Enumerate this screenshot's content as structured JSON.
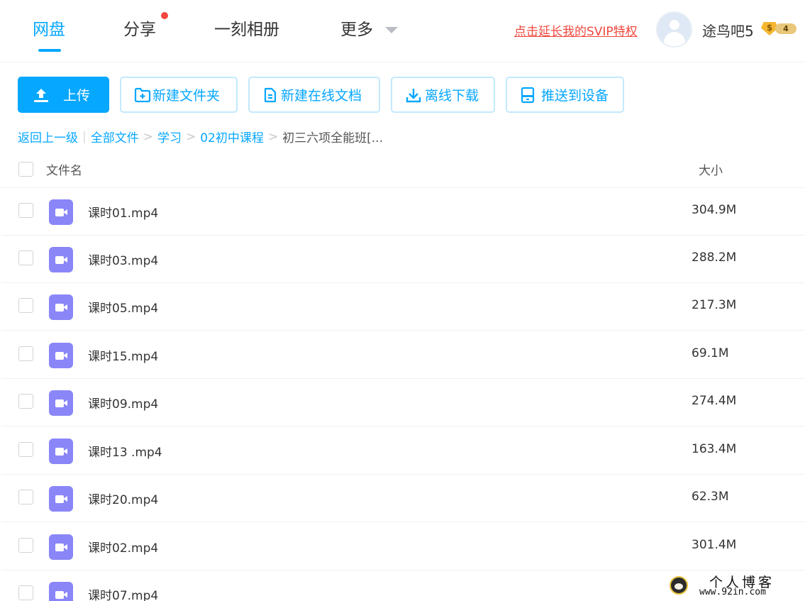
{
  "nav": {
    "tabs": [
      {
        "label": "网盘"
      },
      {
        "label": "分享"
      },
      {
        "label": "一刻相册"
      },
      {
        "label": "更多"
      }
    ],
    "svip_link": "点击延长我的SVIP特权",
    "username": "途鸟吧5",
    "badge_symbol": "$",
    "badge_level": "4"
  },
  "toolbar": {
    "upload": "上传",
    "new_folder": "新建文件夹",
    "new_doc": "新建在线文档",
    "offline_download": "离线下载",
    "push_device": "推送到设备"
  },
  "breadcrumb": {
    "back": "返回上一级",
    "items": [
      "全部文件",
      "学习",
      "02初中课程"
    ],
    "current": "初三六项全能班[..."
  },
  "table": {
    "headers": {
      "name": "文件名",
      "size": "大小"
    },
    "rows": [
      {
        "name": "课时01.mp4",
        "size": "304.9M"
      },
      {
        "name": "课时03.mp4",
        "size": "288.2M"
      },
      {
        "name": "课时05.mp4",
        "size": "217.3M"
      },
      {
        "name": "课时15.mp4",
        "size": "69.1M"
      },
      {
        "name": "课时09.mp4",
        "size": "274.4M"
      },
      {
        "name": "课时13 .mp4",
        "size": "163.4M"
      },
      {
        "name": "课时20.mp4",
        "size": "62.3M"
      },
      {
        "name": "课时02.mp4",
        "size": "301.4M"
      },
      {
        "name": "课时07.mp4",
        "size": ""
      }
    ]
  },
  "watermark": {
    "title": "个人博客",
    "url": "www.92in.com"
  },
  "colors": {
    "accent": "#06a7ff",
    "alert": "#f0483e",
    "video_icon": "#8b86f8"
  }
}
